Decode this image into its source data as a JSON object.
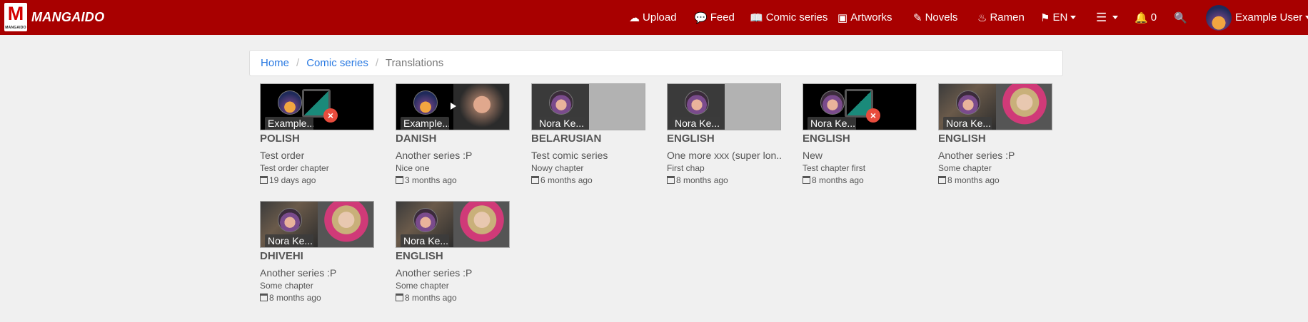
{
  "brand": {
    "logo_letter": "M",
    "logo_small": "MANGAIDO",
    "name": "MANGAIDO"
  },
  "nav": {
    "upload": "Upload",
    "feed": "Feed",
    "comic_series": "Comic series",
    "artworks": "Artworks",
    "novels": "Novels",
    "ramen": "Ramen",
    "language": "EN",
    "notifications": "0",
    "user": "Example User"
  },
  "breadcrumb": {
    "home": "Home",
    "comic_series": "Comic series",
    "current": "Translations"
  },
  "cards": [
    {
      "author": "Example...",
      "language": "POLISH",
      "series": "Test order",
      "chapter": "Test order chapter",
      "date": "19 days ago"
    },
    {
      "author": "Example...",
      "language": "DANISH",
      "series": "Another series :P",
      "chapter": "Nice one",
      "date": "3 months ago"
    },
    {
      "author": "Nora Ke...",
      "language": "BELARUSIAN",
      "series": "Test comic series",
      "chapter": "Nowy chapter",
      "date": "6 months ago"
    },
    {
      "author": "Nora Ke...",
      "language": "ENGLISH",
      "series": "One more xxx (super lon...",
      "chapter": "First chap",
      "date": "8 months ago"
    },
    {
      "author": "Nora Ke...",
      "language": "ENGLISH",
      "series": "New",
      "chapter": "Test chapter first",
      "date": "8 months ago"
    },
    {
      "author": "Nora Ke...",
      "language": "ENGLISH",
      "series": "Another series :P",
      "chapter": "Some chapter",
      "date": "8 months ago"
    },
    {
      "author": "Nora Ke...",
      "language": "DHIVEHI",
      "series": "Another series :P",
      "chapter": "Some chapter",
      "date": "8 months ago"
    },
    {
      "author": "Nora Ke...",
      "language": "ENGLISH",
      "series": "Another series :P",
      "chapter": "Some chapter",
      "date": "8 months ago"
    }
  ],
  "colors": {
    "navbar": "#a80000",
    "link": "#2a7ae2",
    "background": "#f0f0f0",
    "remove_badge": "#e84c3d"
  }
}
